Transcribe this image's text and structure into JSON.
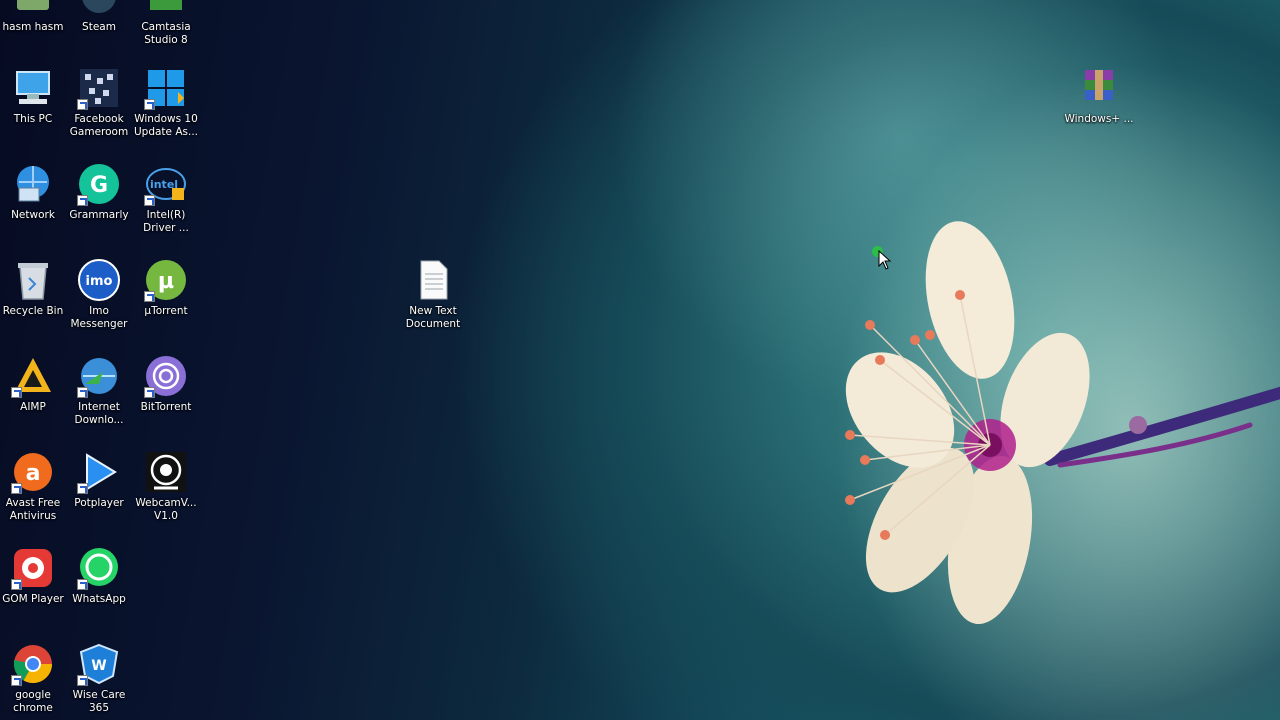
{
  "desktop": {
    "icons": [
      {
        "id": "hasm",
        "label": "hasm hasm"
      },
      {
        "id": "steam",
        "label": "Steam"
      },
      {
        "id": "camtasia",
        "label": "Camtasia\nStudio 8"
      },
      {
        "id": "thispc",
        "label": "This PC"
      },
      {
        "id": "fbgameroom",
        "label": "Facebook\nGameroom"
      },
      {
        "id": "win10",
        "label": "Windows 10\nUpdate As..."
      },
      {
        "id": "network",
        "label": "Network"
      },
      {
        "id": "grammarly",
        "label": "Grammarly"
      },
      {
        "id": "intel",
        "label": "Intel(R)\nDriver ..."
      },
      {
        "id": "recycle",
        "label": "Recycle Bin"
      },
      {
        "id": "imo",
        "label": "Imo\nMessenger"
      },
      {
        "id": "utorrent",
        "label": "µTorrent"
      },
      {
        "id": "aimp",
        "label": "AIMP"
      },
      {
        "id": "idm",
        "label": "Internet\nDownlo..."
      },
      {
        "id": "bittorrent",
        "label": "BitTorrent"
      },
      {
        "id": "avast",
        "label": "Avast Free\nAntivirus"
      },
      {
        "id": "potplayer",
        "label": "Potplayer"
      },
      {
        "id": "webcam",
        "label": "WebcamV...\nV1.0"
      },
      {
        "id": "gom",
        "label": "GOM Player"
      },
      {
        "id": "whatsapp",
        "label": "WhatsApp"
      },
      {
        "id": "chrome",
        "label": "google\nchrome"
      },
      {
        "id": "wisecare",
        "label": "Wise Care\n365"
      },
      {
        "id": "newtext",
        "label": "New Text\nDocument"
      },
      {
        "id": "winrar",
        "label": "Windows+ ..."
      }
    ]
  },
  "colors": {
    "steam": "#1b2838",
    "grammarly": "#15c39a",
    "utorrent": "#76b83f",
    "bittorrent": "#8a6fd6",
    "imo": "#1d5dc7",
    "aimp": "#f3b31b",
    "avast": "#f06b1e",
    "gom": "#e53935",
    "whatsapp": "#25d366",
    "win10": "#1e9ae8"
  }
}
